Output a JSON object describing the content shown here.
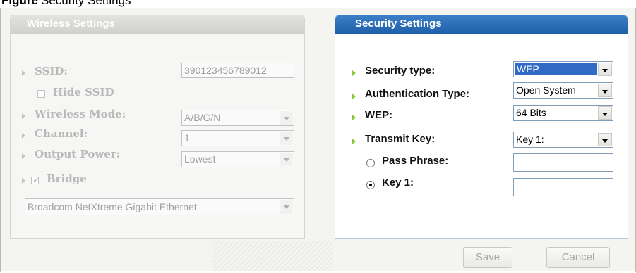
{
  "caption": {
    "label": "Figure",
    "text": "Security Settings"
  },
  "wireless": {
    "title": "Wireless Settings",
    "ssid_label": "SSID:",
    "ssid_value": "390123456789012",
    "hide_ssid_label": "Hide SSID",
    "hide_ssid_checked": false,
    "mode_label": "Wireless Mode:",
    "mode_value": "A/B/G/N",
    "channel_label": "Channel:",
    "channel_value": "1",
    "power_label": "Output Power:",
    "power_value": "Lowest",
    "bridge_label": "Bridge",
    "bridge_checked": true,
    "adapter_value": "Broadcom NetXtreme Gigabit Ethernet"
  },
  "security": {
    "title": "Security Settings",
    "type_label": "Security type:",
    "type_value": "WEP",
    "auth_label": "Authentication Type:",
    "auth_value": "Open System",
    "wep_label": "WEP:",
    "wep_value": "64 Bits",
    "transmit_label": "Transmit Key:",
    "transmit_value": "Key  1:",
    "pass_label": "Pass Phrase:",
    "pass_value": "",
    "key1_label": "Key 1:",
    "key1_value": "",
    "selected_option": "Key 1:"
  },
  "actions": {
    "save_label": "Save",
    "cancel_label": "Cancel"
  },
  "colors": {
    "header_blue": "#1d5ea8",
    "bullet_green": "#8bc53f",
    "disabled_text": "#b8b8b8"
  }
}
